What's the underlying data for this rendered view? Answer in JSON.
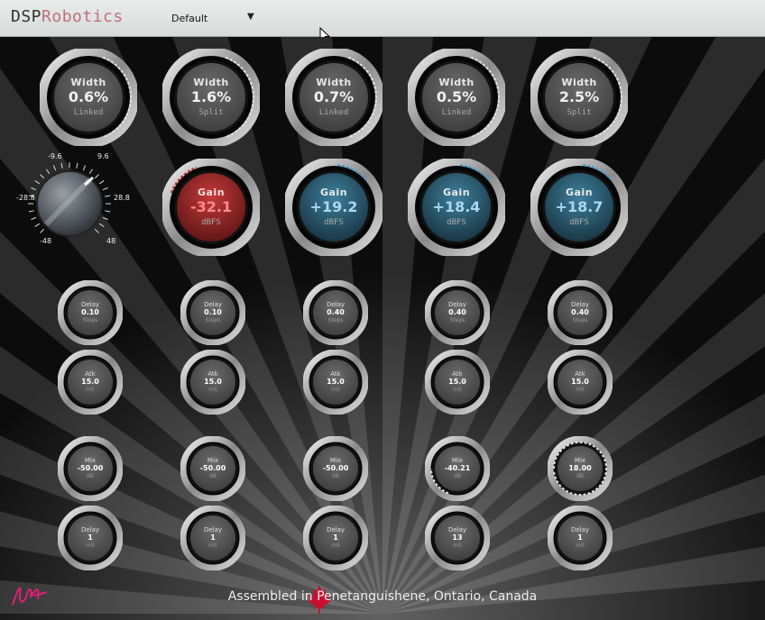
{
  "topbar": {
    "brand_prefix": "DSP",
    "brand_suffix": "Robotics",
    "preset": "Default",
    "preset_arrow": "▼"
  },
  "width_knobs": [
    {
      "label": "Width",
      "value": "0.6%",
      "sub": "Linked"
    },
    {
      "label": "Width",
      "value": "1.6%",
      "sub": "Split"
    },
    {
      "label": "Width",
      "value": "0.7%",
      "sub": "Linked"
    },
    {
      "label": "Width",
      "value": "0.5%",
      "sub": "Linked"
    },
    {
      "label": "Width",
      "value": "2.5%",
      "sub": "Split"
    }
  ],
  "gain_dial": {
    "ticks": [
      "-9.6",
      "9.6",
      "-28.8",
      "28.8",
      "-48",
      "48"
    ]
  },
  "gain_knobs": [
    {
      "label": "Gain",
      "value": "-32.1",
      "sub": "dBFS",
      "color": "#c62828"
    },
    {
      "label": "Gain",
      "value": "+19.2",
      "sub": "dBFS",
      "color": "#3a9ed8"
    },
    {
      "label": "Gain",
      "value": "+18.4",
      "sub": "dBFS",
      "color": "#3a9ed8"
    },
    {
      "label": "Gain",
      "value": "+18.7",
      "sub": "dBFS",
      "color": "#3a9ed8"
    }
  ],
  "delay_step_knobs": [
    {
      "label": "Delay",
      "value": "0.10",
      "sub": "Steps"
    },
    {
      "label": "Delay",
      "value": "0.10",
      "sub": "Steps"
    },
    {
      "label": "Delay",
      "value": "0.40",
      "sub": "Steps"
    },
    {
      "label": "Delay",
      "value": "0.40",
      "sub": "Steps"
    },
    {
      "label": "Delay",
      "value": "0.40",
      "sub": "Steps"
    }
  ],
  "atk_knobs": [
    {
      "label": "Atk",
      "value": "15.0",
      "sub": "mS"
    },
    {
      "label": "Atk",
      "value": "15.0",
      "sub": "mS"
    },
    {
      "label": "Atk",
      "value": "15.0",
      "sub": "mS"
    },
    {
      "label": "Atk",
      "value": "15.0",
      "sub": "mS"
    },
    {
      "label": "Atk",
      "value": "15.0",
      "sub": "mS"
    }
  ],
  "mix_knobs": [
    {
      "label": "Mix",
      "value": "-50.00",
      "sub": "dB"
    },
    {
      "label": "Mix",
      "value": "-50.00",
      "sub": "dB"
    },
    {
      "label": "Mix",
      "value": "-50.00",
      "sub": "dB"
    },
    {
      "label": "Mix",
      "value": "-40.21",
      "sub": "dB"
    },
    {
      "label": "Mix",
      "value": "18.00",
      "sub": "dB"
    }
  ],
  "delay_ms_knobs": [
    {
      "label": "Delay",
      "value": "1",
      "sub": "mS"
    },
    {
      "label": "Delay",
      "value": "1",
      "sub": "mS"
    },
    {
      "label": "Delay",
      "value": "1",
      "sub": "mS"
    },
    {
      "label": "Delay",
      "value": "13",
      "sub": "mS"
    },
    {
      "label": "Delay",
      "value": "1",
      "sub": "mS"
    }
  ],
  "footer": {
    "text": "Assembled in Penetanguishene, Ontario, Canada"
  },
  "icons": {
    "signature": "signature-icon",
    "maple_leaf": "maple-leaf-icon",
    "cursor": "mouse-cursor-icon",
    "dropdown": "dropdown-arrow-icon"
  }
}
